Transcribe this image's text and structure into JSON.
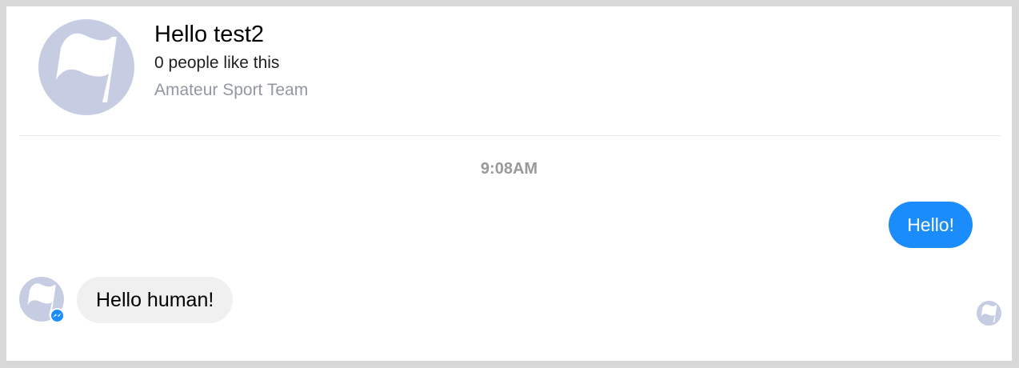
{
  "header": {
    "page_title": "Hello test2",
    "likes": "0 people like this",
    "category": "Amateur Sport Team",
    "avatar_icon": "flag-icon"
  },
  "conversation": {
    "timestamp": "9:08AM",
    "messages": [
      {
        "sender": "user",
        "text": "Hello!"
      },
      {
        "sender": "page",
        "text": "Hello human!"
      }
    ],
    "bot_avatar_icon": "flag-icon",
    "badge_icon": "messenger-icon",
    "read_receipt_icon": "flag-icon"
  },
  "colors": {
    "outgoing_bubble": "#1a8cfb",
    "incoming_bubble": "#f1f0f0",
    "avatar_bg": "#c6cde3",
    "muted_text": "#9197a3"
  }
}
